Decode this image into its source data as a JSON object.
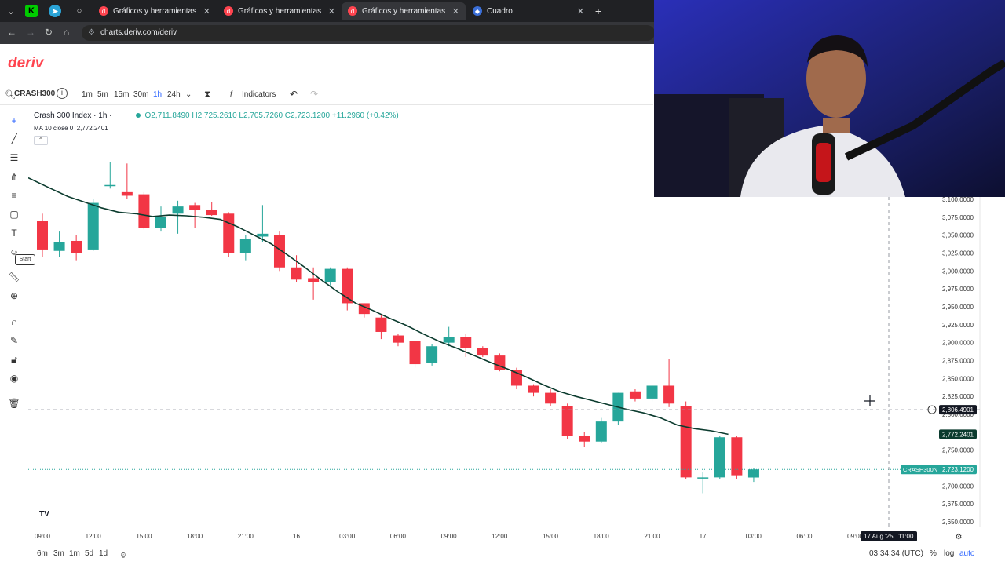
{
  "browser": {
    "tabs": [
      {
        "title": "Gráficos y herramientas de trad",
        "active": false,
        "favicon": "deriv-icon"
      },
      {
        "title": "Gráficos y herramientas de trad",
        "active": false,
        "favicon": "deriv-icon"
      },
      {
        "title": "Gráficos y herramientas de trad",
        "active": true,
        "favicon": "deriv-icon"
      },
      {
        "title": "Cuadro",
        "active": false,
        "favicon": "cuadro-icon"
      }
    ],
    "url": "charts.deriv.com/deriv"
  },
  "app": {
    "logo": "deriv"
  },
  "toolbar": {
    "symbol": "CRASH300",
    "timeframes": [
      "1m",
      "5m",
      "15m",
      "30m",
      "1h",
      "24h"
    ],
    "active_timeframe": "1h",
    "indicators_label": "Indicators"
  },
  "legend": {
    "title": "Crash 300 Index · 1h ·",
    "ohlc": "O2,711.8490  H2,725.2610  L2,705.7260  C2,723.1200  +11.2960 (+0.42%)",
    "ma_label": "MA 10 close 0",
    "ma_value": "2,772.2401"
  },
  "start_label": "Start",
  "bottom": {
    "ranges": [
      "6m",
      "3m",
      "1m",
      "5d",
      "1d"
    ],
    "clock": "03:34:34 (UTC)",
    "percent": "%",
    "log": "log",
    "auto": "auto"
  },
  "colors": {
    "up": "#26a69a",
    "down": "#f23645",
    "ma": "#0b3b2e",
    "brand": "#ff444f",
    "accent": "#2962ff"
  },
  "chart_data": {
    "type": "candlestick",
    "ylim": [
      2650,
      3100
    ],
    "y_ticks": [
      "2,650.0000",
      "2,675.0000",
      "2,700.0000",
      "2,725.0000",
      "2,750.0000",
      "2,775.0000",
      "2,800.0000",
      "2,825.0000",
      "2,850.0000",
      "2,875.0000",
      "2,900.0000",
      "2,925.0000",
      "2,950.0000",
      "2,975.0000",
      "3,000.0000",
      "3,025.0000",
      "3,050.0000",
      "3,075.0000",
      "3,100.0000"
    ],
    "x_ticks": [
      "09:00",
      "12:00",
      "15:00",
      "18:00",
      "21:00",
      "16",
      "03:00",
      "06:00",
      "09:00",
      "12:00",
      "15:00",
      "18:00",
      "21:00",
      "17",
      "03:00",
      "06:00",
      "09:00"
    ],
    "crosshair_date": "17 Aug '25",
    "crosshair_time": "11:00",
    "crosshair_price": "2,806.4901",
    "ma_label": "2,772.2401",
    "last_label_symbol": "CRASH300N",
    "last_label_price": "2,723.1200",
    "candles": [
      {
        "o": 3070,
        "h": 3080,
        "l": 3020,
        "c": 3030
      },
      {
        "o": 3028,
        "h": 3055,
        "l": 3020,
        "c": 3040
      },
      {
        "o": 3042,
        "h": 3050,
        "l": 3015,
        "c": 3025
      },
      {
        "o": 3030,
        "h": 3100,
        "l": 3028,
        "c": 3095
      },
      {
        "o": 3120,
        "h": 3152,
        "l": 3115,
        "c": 3120
      },
      {
        "o": 3110,
        "h": 3150,
        "l": 3100,
        "c": 3105
      },
      {
        "o": 3107,
        "h": 3110,
        "l": 3058,
        "c": 3060
      },
      {
        "o": 3060,
        "h": 3090,
        "l": 3055,
        "c": 3075
      },
      {
        "o": 3080,
        "h": 3098,
        "l": 3052,
        "c": 3090
      },
      {
        "o": 3092,
        "h": 3095,
        "l": 3060,
        "c": 3085
      },
      {
        "o": 3085,
        "h": 3096,
        "l": 3077,
        "c": 3078
      },
      {
        "o": 3080,
        "h": 3082,
        "l": 3020,
        "c": 3025
      },
      {
        "o": 3025,
        "h": 3050,
        "l": 3015,
        "c": 3045
      },
      {
        "o": 3048,
        "h": 3092,
        "l": 3040,
        "c": 3052
      },
      {
        "o": 3050,
        "h": 3055,
        "l": 3000,
        "c": 3005
      },
      {
        "o": 3005,
        "h": 3022,
        "l": 2985,
        "c": 2988
      },
      {
        "o": 2990,
        "h": 3005,
        "l": 2960,
        "c": 2985
      },
      {
        "o": 2985,
        "h": 3005,
        "l": 2980,
        "c": 3003
      },
      {
        "o": 3003,
        "h": 3005,
        "l": 2945,
        "c": 2955
      },
      {
        "o": 2955,
        "h": 2955,
        "l": 2935,
        "c": 2940
      },
      {
        "o": 2935,
        "h": 2940,
        "l": 2905,
        "c": 2915
      },
      {
        "o": 2910,
        "h": 2912,
        "l": 2895,
        "c": 2900
      },
      {
        "o": 2902,
        "h": 2902,
        "l": 2865,
        "c": 2870
      },
      {
        "o": 2872,
        "h": 2898,
        "l": 2868,
        "c": 2895
      },
      {
        "o": 2900,
        "h": 2922,
        "l": 2895,
        "c": 2908
      },
      {
        "o": 2908,
        "h": 2912,
        "l": 2880,
        "c": 2892
      },
      {
        "o": 2892,
        "h": 2895,
        "l": 2880,
        "c": 2882
      },
      {
        "o": 2882,
        "h": 2885,
        "l": 2860,
        "c": 2862
      },
      {
        "o": 2862,
        "h": 2865,
        "l": 2835,
        "c": 2840
      },
      {
        "o": 2840,
        "h": 2842,
        "l": 2825,
        "c": 2830
      },
      {
        "o": 2830,
        "h": 2835,
        "l": 2812,
        "c": 2815
      },
      {
        "o": 2812,
        "h": 2815,
        "l": 2765,
        "c": 2770
      },
      {
        "o": 2770,
        "h": 2775,
        "l": 2755,
        "c": 2762
      },
      {
        "o": 2762,
        "h": 2795,
        "l": 2760,
        "c": 2790
      },
      {
        "o": 2790,
        "h": 2830,
        "l": 2785,
        "c": 2830
      },
      {
        "o": 2832,
        "h": 2835,
        "l": 2818,
        "c": 2822
      },
      {
        "o": 2822,
        "h": 2842,
        "l": 2818,
        "c": 2840
      },
      {
        "o": 2840,
        "h": 2877,
        "l": 2810,
        "c": 2815
      },
      {
        "o": 2812,
        "h": 2818,
        "l": 2710,
        "c": 2712
      },
      {
        "o": 2712,
        "h": 2720,
        "l": 2690,
        "c": 2712
      },
      {
        "o": 2712,
        "h": 2770,
        "l": 2710,
        "c": 2768
      },
      {
        "o": 2768,
        "h": 2770,
        "l": 2710,
        "c": 2715
      },
      {
        "o": 2711.849,
        "h": 2725.261,
        "l": 2705.726,
        "c": 2723.12
      }
    ],
    "ma": [
      3130,
      3115,
      3104,
      3096,
      3088,
      3082,
      3080,
      3076,
      3078,
      3077,
      3075,
      3072,
      3062,
      3050,
      3038,
      3022,
      3005,
      2987,
      2970,
      2955,
      2945,
      2934,
      2924,
      2912,
      2901,
      2892,
      2882,
      2872,
      2863,
      2853,
      2842,
      2832,
      2825,
      2819,
      2813,
      2807,
      2802,
      2795,
      2785,
      2780,
      2777,
      2772.2401
    ]
  }
}
